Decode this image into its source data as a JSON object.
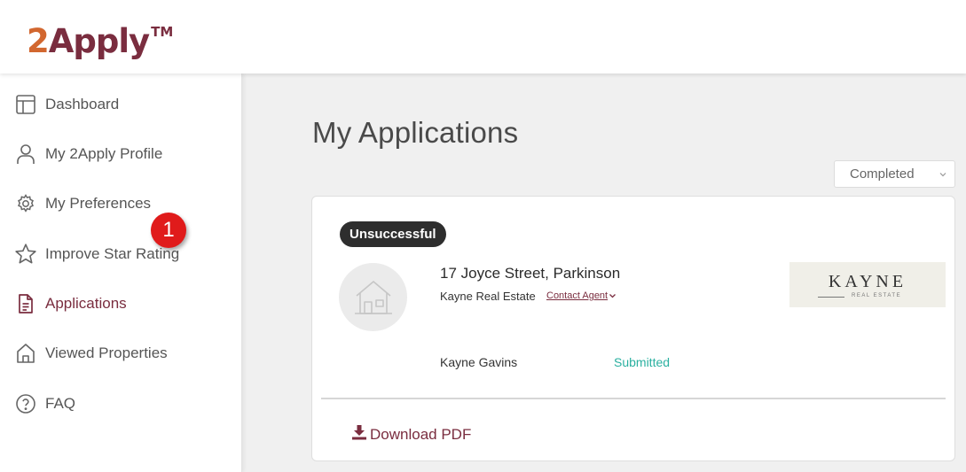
{
  "brand": {
    "logo_two": "2",
    "logo_apply": "Apply",
    "logo_tm": "TM"
  },
  "sidebar": {
    "items": [
      {
        "label": "Dashboard",
        "icon": "layout-icon"
      },
      {
        "label": "My 2Apply Profile",
        "icon": "user-icon"
      },
      {
        "label": "My Preferences",
        "icon": "gear-icon"
      },
      {
        "label": "Improve Star Rating",
        "icon": "star-icon"
      },
      {
        "label": "Applications",
        "icon": "document-icon",
        "active": true
      },
      {
        "label": "Viewed Properties",
        "icon": "house-icon"
      },
      {
        "label": "FAQ",
        "icon": "question-icon"
      }
    ],
    "callout_number": "1"
  },
  "main": {
    "title": "My Applications",
    "filter": {
      "selected": "Completed"
    },
    "application": {
      "status_badge": "Unsuccessful",
      "address": "17 Joyce Street, Parkinson",
      "agency": "Kayne Real Estate",
      "contact_link": "Contact Agent",
      "agency_logo_name": "KAYNE",
      "agency_logo_sub": "REAL ESTATE",
      "applicant": "Kayne Gavins",
      "submission_status": "Submitted",
      "download_label": "Download PDF"
    }
  },
  "colors": {
    "brand_orange": "#d2672f",
    "brand_maroon": "#7a2d3f",
    "submitted_teal": "#2ab0a0",
    "callout_red": "#e01b1b",
    "badge_dark": "#2e2e2e"
  }
}
